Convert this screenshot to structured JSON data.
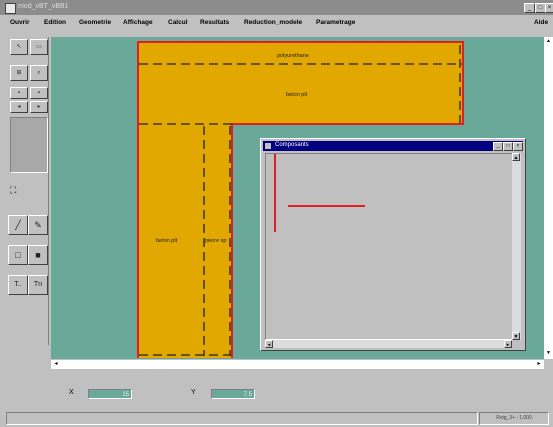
{
  "window": {
    "title": "mod_vBT_vBB1"
  },
  "menu": {
    "items": [
      "Ouvrir",
      "Edition",
      "Geometrie",
      "Affichage",
      "Calcul",
      "Resultats",
      "Reduction_modele",
      "Parametrage"
    ],
    "right_item": "Aide"
  },
  "toolbox": {
    "icons": [
      "cursor-icon",
      "select-box-icon",
      "zoom-fit-icon",
      "zoom-icon",
      "tool-a-icon",
      "tool-b-icon",
      "tool-c-icon",
      "tool-d-icon",
      "fit-view-icon",
      "line-icon",
      "pencil-icon",
      "rectangle-icon",
      "filled-rectangle-icon",
      "text-icon",
      "text-alt-icon"
    ]
  },
  "canvas": {
    "background_color": "#6aa89a",
    "piece_color": "#e0a800",
    "outline_color": "#e02020",
    "labels": {
      "top_strip": "polyurethane",
      "top_band": "beton plt",
      "left_column": "beton plt",
      "middle_column": "pierre sp"
    }
  },
  "component_window": {
    "title": "Composants"
  },
  "coords": {
    "x_label": "X",
    "x_value": "15",
    "y_label": "Y",
    "y_value": "7.5"
  },
  "status": {
    "right_text": "Rvtg_3+ : 1,000"
  }
}
